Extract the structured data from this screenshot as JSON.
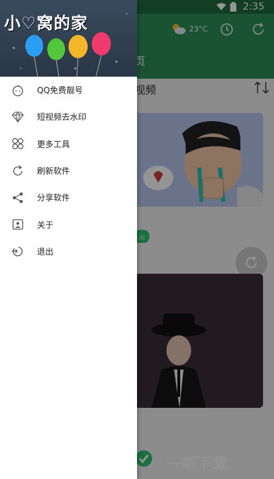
{
  "status_bar": {
    "time": "2:35"
  },
  "header": {
    "logo_text": "小♡窝的家",
    "weather_temp": "23°C",
    "tab_label": "页"
  },
  "main": {
    "section_title": "视频",
    "tag_label": "火"
  },
  "drawer": {
    "items": [
      {
        "label": "QQ免费靓号",
        "icon": "qq-face-icon"
      },
      {
        "label": "短视频去水印",
        "icon": "diamond-icon"
      },
      {
        "label": "更多工具",
        "icon": "tools-grid-icon"
      },
      {
        "label": "刷新软件",
        "icon": "refresh-icon"
      },
      {
        "label": "分享软件",
        "icon": "share-icon"
      },
      {
        "label": "关于",
        "icon": "about-icon"
      },
      {
        "label": "退出",
        "icon": "exit-icon"
      }
    ]
  },
  "watermark": "一听下载",
  "colors": {
    "primary": "#2e8f57",
    "status": "#1f6b3e",
    "accent_green": "#2ec36c"
  }
}
